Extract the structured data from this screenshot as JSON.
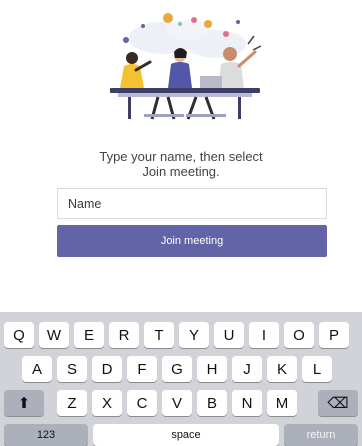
{
  "prompt": {
    "line1": "Type your name, then select",
    "line2": "Join meeting."
  },
  "name_input": {
    "placeholder": "Name",
    "value": ""
  },
  "join_button": {
    "label": "Join meeting"
  },
  "keyboard": {
    "row1": [
      "Q",
      "W",
      "E",
      "R",
      "T",
      "Y",
      "U",
      "I",
      "O",
      "P"
    ],
    "row2": [
      "A",
      "S",
      "D",
      "F",
      "G",
      "H",
      "J",
      "K",
      "L"
    ],
    "row3": [
      "Z",
      "X",
      "C",
      "V",
      "B",
      "N",
      "M"
    ],
    "numbers_key": "123",
    "space_key": "space",
    "return_key": "return",
    "shift_glyph": "⬆",
    "delete_glyph": "⌫"
  },
  "colors": {
    "accent": "#6264a7",
    "keyboard_bg": "#d1d3d9"
  }
}
